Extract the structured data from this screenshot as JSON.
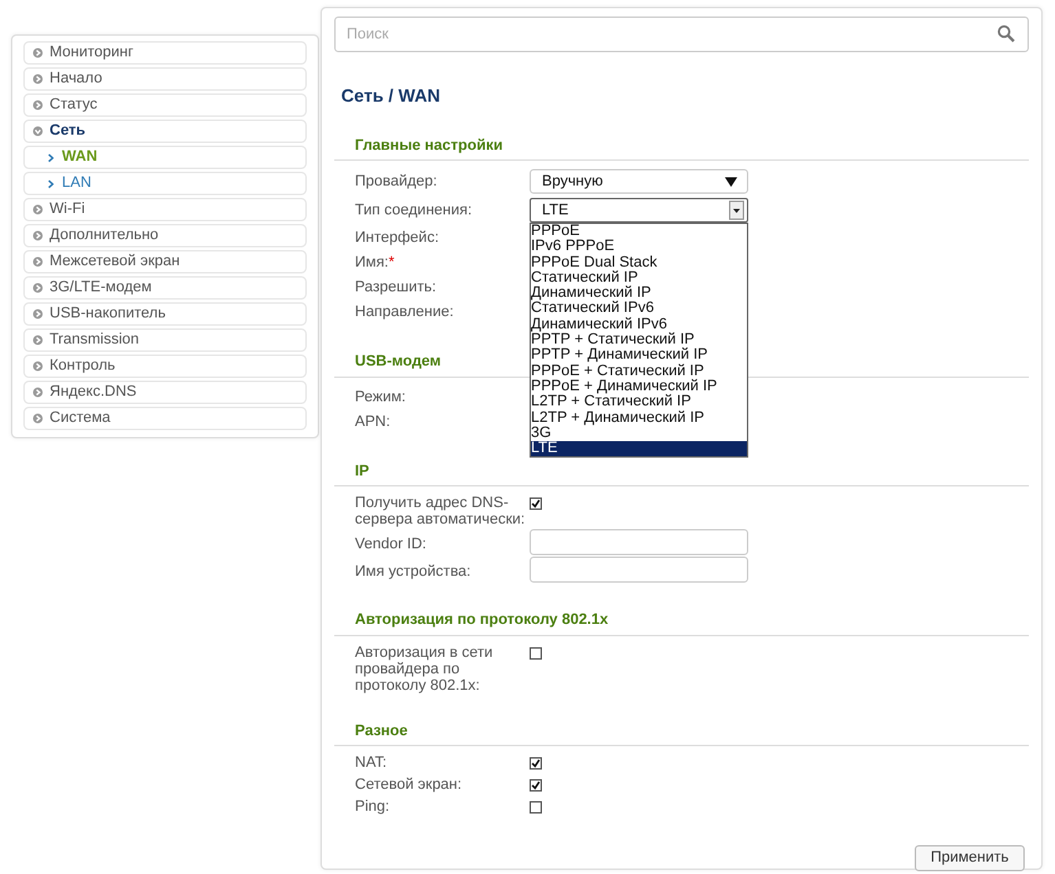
{
  "sidebar": {
    "items": [
      {
        "label": "Мониторинг",
        "expanded": false
      },
      {
        "label": "Начало",
        "expanded": false
      },
      {
        "label": "Статус",
        "expanded": false
      },
      {
        "label": "Сеть",
        "expanded": true,
        "children": [
          {
            "label": "WAN",
            "selected": true
          },
          {
            "label": "LAN",
            "selected": false
          }
        ]
      },
      {
        "label": "Wi-Fi",
        "expanded": false
      },
      {
        "label": "Дополнительно",
        "expanded": false
      },
      {
        "label": "Межсетевой экран",
        "expanded": false
      },
      {
        "label": "3G/LTE-модем",
        "expanded": false
      },
      {
        "label": "USB-накопитель",
        "expanded": false
      },
      {
        "label": "Transmission",
        "expanded": false
      },
      {
        "label": "Контроль",
        "expanded": false
      },
      {
        "label": "Яндекс.DNS",
        "expanded": false
      },
      {
        "label": "Система",
        "expanded": false
      }
    ]
  },
  "search": {
    "placeholder": "Поиск"
  },
  "title": "Сеть /  WAN",
  "sections": [
    {
      "title": "Главные настройки",
      "rows": [
        {
          "kind": "select",
          "label": "Провайдер:",
          "value": "Вручную",
          "expanded": false
        },
        {
          "kind": "select",
          "label": "Тип соединения:",
          "value": "LTE",
          "expanded": true,
          "options": [
            {
              "label": "PPPoE",
              "selected": false
            },
            {
              "label": "IPv6 PPPoE",
              "selected": false
            },
            {
              "label": "PPPoE Dual Stack",
              "selected": false
            },
            {
              "label": "Статический IP",
              "selected": false
            },
            {
              "label": "Динамический IP",
              "selected": false
            },
            {
              "label": "Статический IPv6",
              "selected": false
            },
            {
              "label": "Динамический IPv6",
              "selected": false
            },
            {
              "label": "PPTP + Статический IP",
              "selected": false
            },
            {
              "label": "PPTP + Динамический IP",
              "selected": false
            },
            {
              "label": "PPPoE + Статический IP",
              "selected": false
            },
            {
              "label": "PPPoE + Динамический IP",
              "selected": false
            },
            {
              "label": "L2TP + Статический IP",
              "selected": false
            },
            {
              "label": "L2TP + Динамический IP",
              "selected": false
            },
            {
              "label": "3G",
              "selected": false
            },
            {
              "label": "LTE",
              "selected": true
            }
          ]
        },
        {
          "kind": "label",
          "label": "Интерфейс:"
        },
        {
          "kind": "label",
          "label": "Имя:",
          "required_mark": "*"
        },
        {
          "kind": "label",
          "label": "Разрешить:"
        },
        {
          "kind": "label",
          "label": "Направление:"
        }
      ]
    },
    {
      "title": "USB-модем",
      "rows": [
        {
          "kind": "label",
          "label": "Режим:"
        },
        {
          "kind": "label",
          "label": "APN:"
        }
      ]
    },
    {
      "title": "IP",
      "rows": [
        {
          "kind": "checkbox",
          "label": "Получить адрес DNS-сервера автоматически:",
          "checked": true
        },
        {
          "kind": "input",
          "label": "Vendor ID:"
        },
        {
          "kind": "input",
          "label": "Имя устройства:"
        }
      ]
    },
    {
      "title": "Авторизация по протоколу 802.1x",
      "rows": [
        {
          "kind": "checkbox",
          "label": "Авторизация в сети провайдера по протоколу 802.1x:",
          "checked": false
        }
      ]
    },
    {
      "title": "Разное",
      "rows": [
        {
          "kind": "checkbox",
          "label": "NAT:",
          "checked": true
        },
        {
          "kind": "checkbox",
          "label": "Сетевой экран:",
          "checked": true
        },
        {
          "kind": "checkbox",
          "label": "Ping:",
          "checked": false
        }
      ]
    }
  ],
  "apply_button": "Применить"
}
